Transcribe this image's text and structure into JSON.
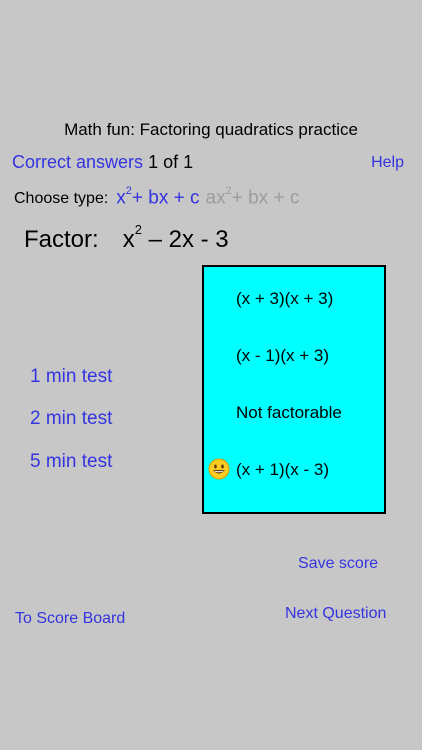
{
  "header": {
    "title": "Math fun: Factoring quadratics practice",
    "correct_label": "Correct answers",
    "correct_count": "1 of 1",
    "help_label": "Help"
  },
  "type_selector": {
    "label": "Choose type:",
    "option_simple": {
      "pre": "x",
      "sup": "2",
      "post": "+ bx + c",
      "selected": true
    },
    "option_general": {
      "pre": "ax",
      "sup": "2",
      "post": "+ bx + c",
      "selected": false
    }
  },
  "problem": {
    "label": "Factor:",
    "pre": "x",
    "sup": "2",
    "post": "– 2x - 3"
  },
  "answers": [
    {
      "text": "(x + 3)(x + 3)"
    },
    {
      "text": "(x - 1)(x + 3)"
    },
    {
      "text": "Not factorable"
    },
    {
      "text": "(x + 1)(x - 3)",
      "marked_correct": true
    }
  ],
  "tests": [
    {
      "label": "1 min test"
    },
    {
      "label": "2 min test"
    },
    {
      "label": "5 min test"
    }
  ],
  "footer": {
    "save_score": "Save score",
    "score_board": "To Score Board",
    "next_question": "Next Question"
  },
  "colors": {
    "background": "#c7c7c7",
    "link_blue": "#3434e0",
    "disabled_gray": "#9c9c9c",
    "answer_box": "#00ffff",
    "smiley_yellow": "#ffcc22"
  },
  "icons": {
    "correct_marker": "smiley-face-icon"
  }
}
